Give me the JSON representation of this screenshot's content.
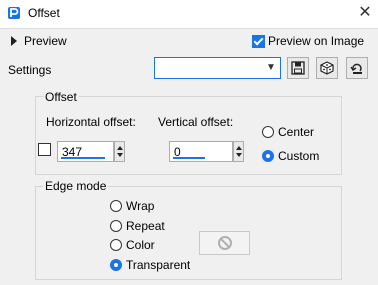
{
  "window": {
    "title": "Offset",
    "close_glyph": "✕"
  },
  "header": {
    "preview_label": "Preview",
    "preview_on_image_label": "Preview on Image",
    "preview_on_image_checked": true
  },
  "settings": {
    "label": "Settings",
    "value": ""
  },
  "toolbar": {
    "icons": [
      "save-icon",
      "randomize-icon",
      "reset-icon"
    ]
  },
  "offset_group": {
    "title": "Offset",
    "horizontal_label": "Horizontal offset:",
    "horizontal_value": "347",
    "vertical_label": "Vertical offset:",
    "vertical_value": "0",
    "checkbox_checked": false,
    "center_label": "Center",
    "custom_label": "Custom",
    "selected": "Custom"
  },
  "edge_mode": {
    "title": "Edge mode",
    "options": [
      "Wrap",
      "Repeat",
      "Color",
      "Transparent"
    ],
    "selected": "Transparent"
  }
}
